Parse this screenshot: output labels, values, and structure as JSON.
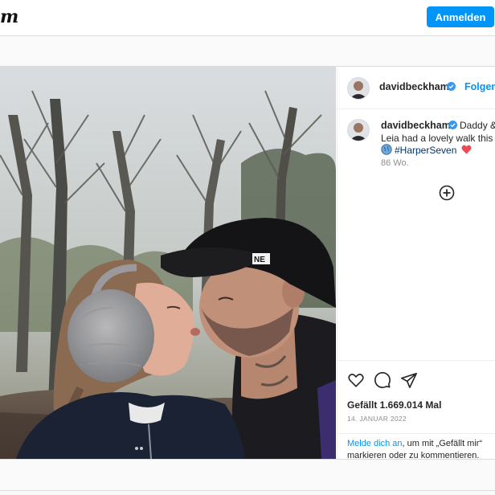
{
  "header": {
    "logo_fragment": "m",
    "login_button": "Anmelden"
  },
  "post": {
    "username": "davidbeckham",
    "follow_label": "Folgen",
    "caption": {
      "line1": "Daddy &",
      "line2": "Leia had a lovely walk this m",
      "hashtag": "#HarperSeven"
    },
    "time_ago": "86 Wo.",
    "likes": "Gefällt 1.669.014 Mal",
    "date": "14. JANUAR 2022",
    "login_prompt": {
      "link": "Melde dich an",
      "rest": ", um mit „Gefällt mir“",
      "line2": "markieren oder zu kommentieren."
    }
  },
  "icons": {
    "verified": "verified-badge-icon",
    "globe": "globe-emoji-icon",
    "heart_emoji": "red-heart-emoji-icon",
    "add": "plus-circle-icon",
    "like": "heart-icon",
    "comment": "comment-icon",
    "share": "share-icon"
  },
  "colors": {
    "accent": "#0095f6",
    "verified": "#3897f0",
    "hashtag": "#00376b",
    "heart": "#ed4956"
  }
}
